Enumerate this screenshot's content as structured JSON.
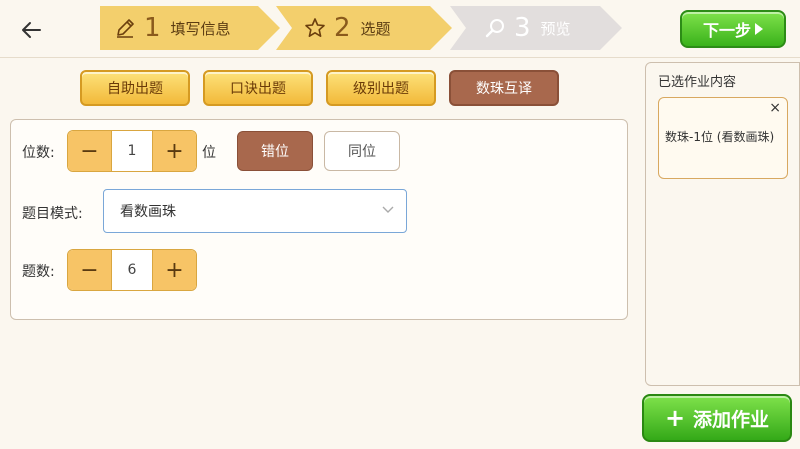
{
  "header": {
    "steps": [
      {
        "num": "1",
        "label": "填写信息",
        "icon": "pencil-icon"
      },
      {
        "num": "2",
        "label": "选题",
        "icon": "star-icon"
      },
      {
        "num": "3",
        "label": "预览",
        "icon": "search-icon"
      }
    ],
    "next_label": "下一步"
  },
  "modes": [
    {
      "label": "自助出题"
    },
    {
      "label": "口诀出题"
    },
    {
      "label": "级别出题"
    },
    {
      "label": "数珠互译",
      "active": true
    }
  ],
  "form": {
    "digits": {
      "label": "位数:",
      "minus": "−",
      "value": "1",
      "plus": "+",
      "unit": "位"
    },
    "position_options": {
      "staggered": "错位",
      "same": "同位",
      "selected": "错位"
    },
    "mode": {
      "label": "题目模式:",
      "value": "看数画珠"
    },
    "count": {
      "label": "题数:",
      "minus": "−",
      "value": "6",
      "plus": "+"
    }
  },
  "sidebar": {
    "title": "已选作业内容",
    "items": [
      {
        "text": "数珠-1位 (看数画珠)",
        "close": "×"
      }
    ]
  },
  "add_button": {
    "plus": "+",
    "label": "添加作业"
  },
  "colors": {
    "step_active": "#f3cf6c",
    "step_inactive": "#e2dedd",
    "mode_active": "#a8684d",
    "green_button": "#3ab21b"
  }
}
